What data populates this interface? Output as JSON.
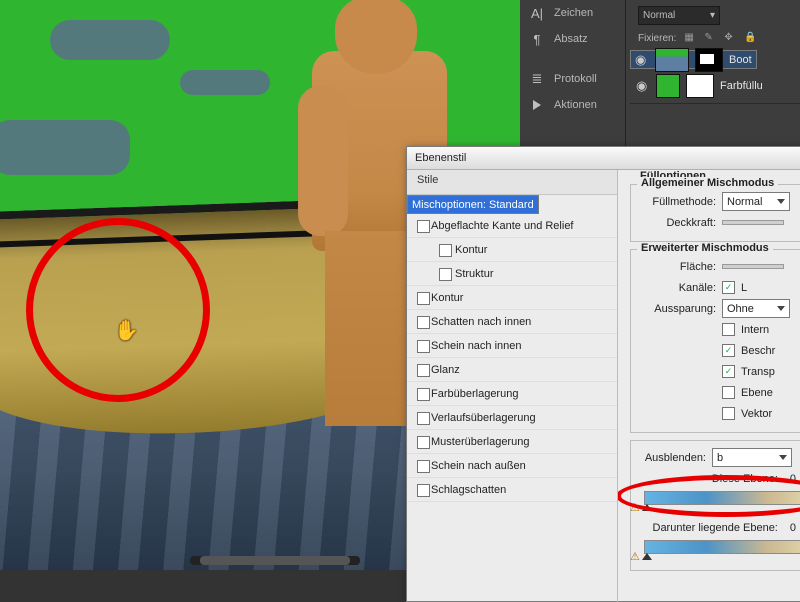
{
  "palette": {
    "panels": {
      "zeichen": "Zeichen",
      "absatz": "Absatz",
      "protokoll": "Protokoll",
      "aktionen": "Aktionen"
    },
    "layers": {
      "blend_mode": "Normal",
      "lock_label": "Fixieren:",
      "items": [
        {
          "name": "Boot"
        },
        {
          "name": "Farbfüllu"
        }
      ]
    }
  },
  "dialog": {
    "title": "Ebenenstil",
    "styles_header": "Stile",
    "styles": [
      {
        "label": "Mischoptionen: Standard",
        "checkbox": false,
        "selected": true,
        "sub": false
      },
      {
        "label": "Abgeflachte Kante und Relief",
        "checkbox": true,
        "selected": false,
        "sub": false
      },
      {
        "label": "Kontur",
        "checkbox": true,
        "selected": false,
        "sub": true
      },
      {
        "label": "Struktur",
        "checkbox": true,
        "selected": false,
        "sub": true
      },
      {
        "label": "Kontur",
        "checkbox": true,
        "selected": false,
        "sub": false
      },
      {
        "label": "Schatten nach innen",
        "checkbox": true,
        "selected": false,
        "sub": false
      },
      {
        "label": "Schein nach innen",
        "checkbox": true,
        "selected": false,
        "sub": false
      },
      {
        "label": "Glanz",
        "checkbox": true,
        "selected": false,
        "sub": false
      },
      {
        "label": "Farbüberlagerung",
        "checkbox": true,
        "selected": false,
        "sub": false
      },
      {
        "label": "Verlaufsüberlagerung",
        "checkbox": true,
        "selected": false,
        "sub": false
      },
      {
        "label": "Musterüberlagerung",
        "checkbox": true,
        "selected": false,
        "sub": false
      },
      {
        "label": "Schein nach außen",
        "checkbox": true,
        "selected": false,
        "sub": false
      },
      {
        "label": "Schlagschatten",
        "checkbox": true,
        "selected": false,
        "sub": false
      }
    ],
    "opts": {
      "fill_options": "Fülloptionen",
      "general": "Allgemeiner Mischmodus",
      "blend_method_label": "Füllmethode:",
      "blend_method_value": "Normal",
      "opacity_label": "Deckkraft:",
      "advanced": "Erweiterter Mischmodus",
      "fill_label": "Fläche:",
      "channels_label": "Kanäle:",
      "channel_l": "L",
      "knockout_label": "Aussparung:",
      "knockout_value": "Ohne",
      "cb1": "Intern",
      "cb2": "Beschr",
      "cb3": "Transp",
      "cb4": "Ebene",
      "cb5": "Vektor",
      "blendif_label": "Ausblenden:",
      "blendif_value": "b",
      "this_layer": "Diese Ebene:",
      "this_value": "0",
      "under_layer": "Darunter liegende Ebene:",
      "under_value": "0"
    }
  }
}
